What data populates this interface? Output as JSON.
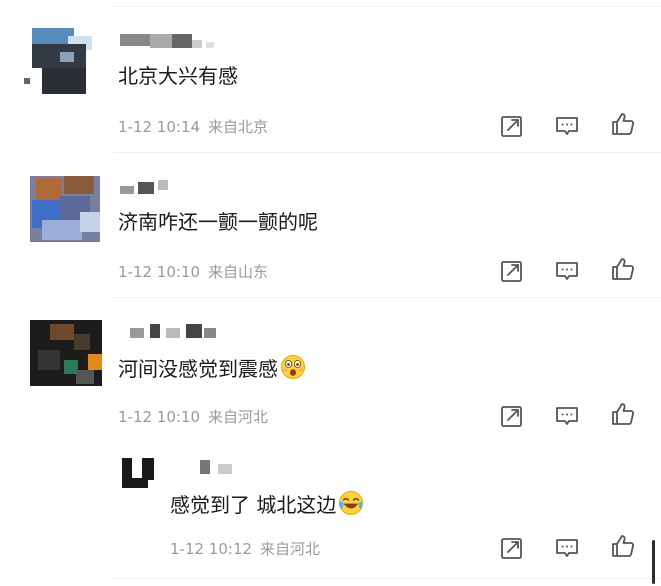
{
  "comments": [
    {
      "text": "北京大兴有感",
      "time": "1-12 10:14",
      "location": "来自北京"
    },
    {
      "text": "济南咋还一颤一颤的呢",
      "time": "1-12 10:10",
      "location": "来自山东"
    },
    {
      "text": "河间没感觉到震感",
      "emoji": "astonished-face-emoji",
      "time": "1-12 10:10",
      "location": "来自河北"
    }
  ],
  "reply": {
    "text": "感觉到了 城北这边",
    "emoji": "laughing-crying-face-emoji",
    "time": "1-12 10:12",
    "location": "来自河北"
  },
  "icons": {
    "repost": "share-edit-icon",
    "comment": "comment-bubble-icon",
    "like": "thumbs-up-icon"
  },
  "colors": {
    "text": "#1a1a1a",
    "meta": "#9a9a9a",
    "icon": "#555555",
    "divider": "#ededed"
  }
}
